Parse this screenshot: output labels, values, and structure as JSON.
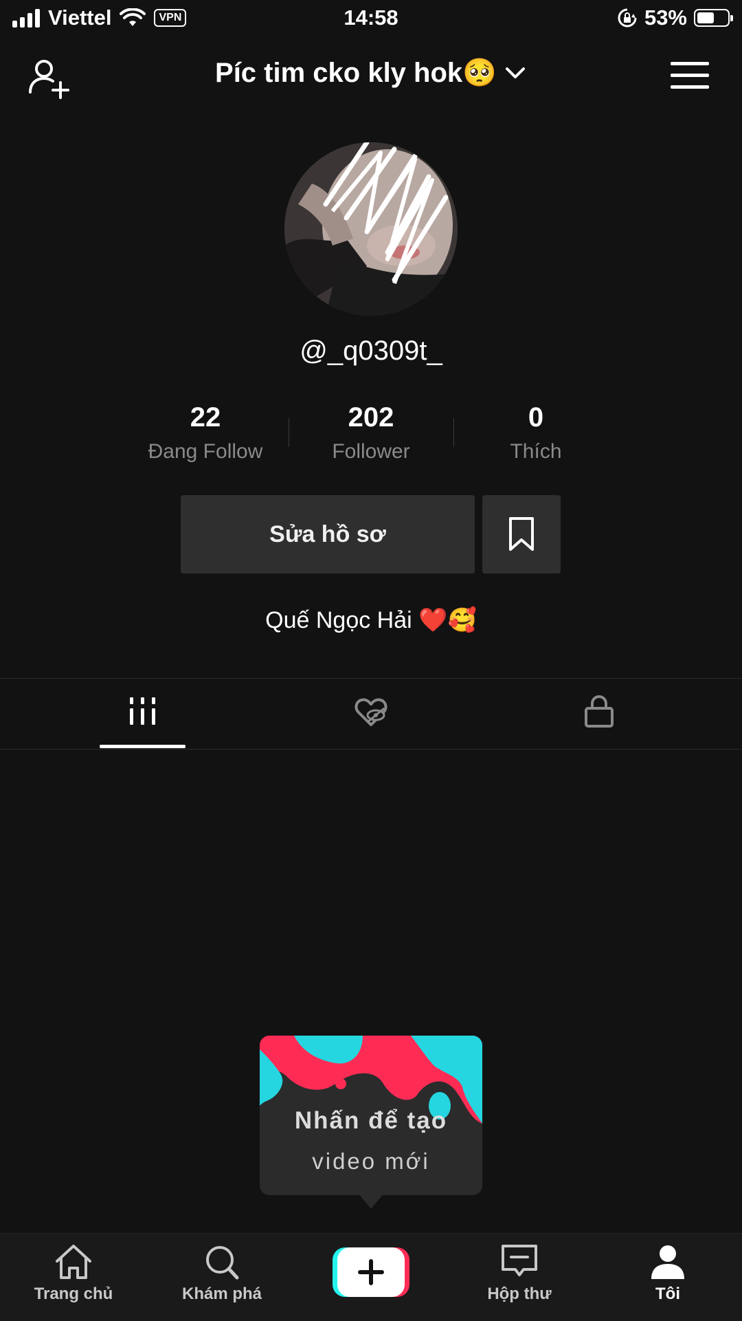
{
  "status_bar": {
    "carrier": "Viettel",
    "vpn": "VPN",
    "time": "14:58",
    "battery": "53%",
    "battery_level": 0.53
  },
  "header": {
    "title": "Píc tim cko kly hok🥺",
    "add_user_icon": "add-user-icon",
    "menu_icon": "hamburger-menu-icon",
    "dropdown_icon": "chevron-down-icon"
  },
  "profile": {
    "username": "@_q0309t_",
    "stats": [
      {
        "value": "22",
        "label": "Đang Follow"
      },
      {
        "value": "202",
        "label": "Follower"
      },
      {
        "value": "0",
        "label": "Thích"
      }
    ],
    "edit_button": "Sửa hồ sơ",
    "bio": "Quế Ngọc Hải ❤️🥰"
  },
  "tabs": [
    {
      "name": "videos",
      "icon": "grid-icon",
      "active": true
    },
    {
      "name": "liked",
      "icon": "hidden-heart-icon",
      "active": false
    },
    {
      "name": "private",
      "icon": "lock-icon",
      "active": false
    }
  ],
  "create_tooltip": {
    "line1": "Nhấn để tạo",
    "line2": "video mới"
  },
  "bottom_nav": [
    {
      "label": "Trang chủ",
      "icon": "home-icon"
    },
    {
      "label": "Khám phá",
      "icon": "search-icon"
    },
    {
      "label": "",
      "icon": "create-plus-icon"
    },
    {
      "label": "Hộp thư",
      "icon": "inbox-icon"
    },
    {
      "label": "Tôi",
      "icon": "profile-icon",
      "active": true
    }
  ],
  "colors": {
    "background": "#121212",
    "tiktok_red": "#fe2c55",
    "tiktok_cyan": "#25f4ee",
    "button_bg": "#2f2f2f"
  }
}
